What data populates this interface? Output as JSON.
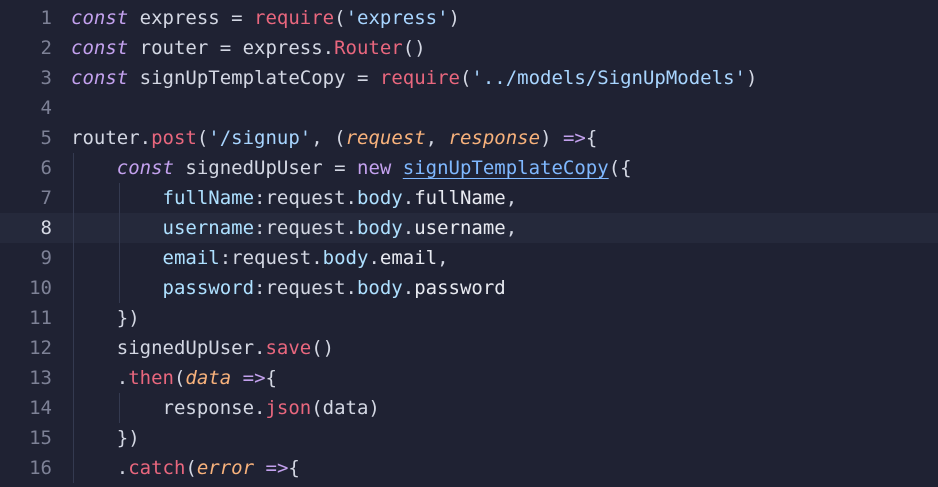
{
  "editor": {
    "active_line": "8",
    "lines": [
      {
        "number": "1",
        "segments": [
          [
            "kw",
            "const"
          ],
          [
            "pl",
            " express = "
          ],
          [
            "fn",
            "require"
          ],
          [
            "pl",
            "("
          ],
          [
            "str",
            "'express'"
          ],
          [
            "pl",
            ")"
          ]
        ]
      },
      {
        "number": "2",
        "segments": [
          [
            "kw",
            "const"
          ],
          [
            "pl",
            " router = express."
          ],
          [
            "fn",
            "Router"
          ],
          [
            "pl",
            "()"
          ]
        ]
      },
      {
        "number": "3",
        "segments": [
          [
            "kw",
            "const"
          ],
          [
            "pl",
            " signUpTemplateCopy = "
          ],
          [
            "fn",
            "require"
          ],
          [
            "pl",
            "("
          ],
          [
            "str",
            "'../models/SignUpModels'"
          ],
          [
            "pl",
            ")"
          ]
        ]
      },
      {
        "number": "4",
        "segments": []
      },
      {
        "number": "5",
        "segments": [
          [
            "pl",
            "router."
          ],
          [
            "fn",
            "post"
          ],
          [
            "pl",
            "("
          ],
          [
            "str",
            "'/signup'"
          ],
          [
            "pl",
            ", ("
          ],
          [
            "par",
            "request"
          ],
          [
            "pl",
            ", "
          ],
          [
            "par",
            "response"
          ],
          [
            "pl",
            ") "
          ],
          [
            "arrow",
            "=>"
          ],
          [
            "pl",
            "{"
          ]
        ]
      },
      {
        "number": "6",
        "segments": [
          [
            "pl",
            "    "
          ],
          [
            "kw",
            "const"
          ],
          [
            "pl",
            " signedUpUser = "
          ],
          [
            "kwn",
            "new"
          ],
          [
            "pl",
            " "
          ],
          [
            "cls",
            "signUpTemplateCopy"
          ],
          [
            "pl",
            "({"
          ]
        ]
      },
      {
        "number": "7",
        "segments": [
          [
            "pl",
            "        "
          ],
          [
            "obj",
            "fullName"
          ],
          [
            "pl",
            ":request."
          ],
          [
            "obj",
            "body"
          ],
          [
            "pl",
            "."
          ],
          [
            "prop",
            "fullName"
          ],
          [
            "pl",
            ","
          ]
        ]
      },
      {
        "number": "8",
        "segments": [
          [
            "pl",
            "        "
          ],
          [
            "obj",
            "username"
          ],
          [
            "pl",
            ":request."
          ],
          [
            "obj",
            "body"
          ],
          [
            "pl",
            "."
          ],
          [
            "prop",
            "username"
          ],
          [
            "pl",
            ","
          ]
        ]
      },
      {
        "number": "9",
        "segments": [
          [
            "pl",
            "        "
          ],
          [
            "obj",
            "email"
          ],
          [
            "pl",
            ":request."
          ],
          [
            "obj",
            "body"
          ],
          [
            "pl",
            "."
          ],
          [
            "prop",
            "email"
          ],
          [
            "pl",
            ","
          ]
        ]
      },
      {
        "number": "10",
        "segments": [
          [
            "pl",
            "        "
          ],
          [
            "obj",
            "password"
          ],
          [
            "pl",
            ":request."
          ],
          [
            "obj",
            "body"
          ],
          [
            "pl",
            "."
          ],
          [
            "prop",
            "password"
          ]
        ]
      },
      {
        "number": "11",
        "segments": [
          [
            "pl",
            "    })"
          ]
        ]
      },
      {
        "number": "12",
        "segments": [
          [
            "pl",
            "    signedUpUser."
          ],
          [
            "fn",
            "save"
          ],
          [
            "pl",
            "()"
          ]
        ]
      },
      {
        "number": "13",
        "segments": [
          [
            "pl",
            "    ."
          ],
          [
            "fn",
            "then"
          ],
          [
            "pl",
            "("
          ],
          [
            "par",
            "data"
          ],
          [
            "pl",
            " "
          ],
          [
            "arrow",
            "=>"
          ],
          [
            "pl",
            "{"
          ]
        ]
      },
      {
        "number": "14",
        "segments": [
          [
            "pl",
            "        response."
          ],
          [
            "fn",
            "json"
          ],
          [
            "pl",
            "(data)"
          ]
        ]
      },
      {
        "number": "15",
        "segments": [
          [
            "pl",
            "    })"
          ]
        ]
      },
      {
        "number": "16",
        "segments": [
          [
            "pl",
            "    ."
          ],
          [
            "fn",
            "catch"
          ],
          [
            "pl",
            "("
          ],
          [
            "par",
            "error"
          ],
          [
            "pl",
            " "
          ],
          [
            "arrow",
            "=>"
          ],
          [
            "pl",
            "{"
          ]
        ]
      }
    ]
  }
}
